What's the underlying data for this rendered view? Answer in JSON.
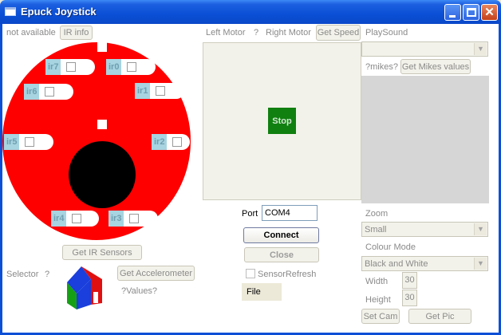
{
  "window": {
    "title": "Epuck Joystick"
  },
  "ir": {
    "status": "not available",
    "info_button": "IR info",
    "sensors": [
      "ir0",
      "ir1",
      "ir2",
      "ir3",
      "ir4",
      "ir5",
      "ir6",
      "ir7"
    ],
    "get_button": "Get IR Sensors"
  },
  "motor": {
    "left_label": "Left Motor",
    "value": "?",
    "right_label": "Right Motor",
    "get_speed_button": "Get Speed",
    "stop_button": "Stop"
  },
  "connection": {
    "port_label": "Port",
    "port_value": "COM4",
    "connect_button": "Connect",
    "close_button": "Close",
    "sensor_refresh_label": "SensorRefresh",
    "file_label": "File"
  },
  "selector": {
    "label": "Selector",
    "value": "?"
  },
  "accel": {
    "button": "Get Accelerometer",
    "values": "?Values?"
  },
  "sound": {
    "label": "PlaySound",
    "selected": "",
    "mikes_label": "?mikes?",
    "mikes_button": "Get Mikes values"
  },
  "camera": {
    "zoom_label": "Zoom",
    "zoom_value": "Small",
    "colour_label": "Colour Mode",
    "colour_value": "Black and White",
    "width_label": "Width",
    "width_value": "30",
    "height_label": "Height",
    "height_value": "30",
    "set_cam_button": "Set Cam",
    "get_pic_button": "Get Pic"
  },
  "colors": {
    "robot": "#ff0000",
    "stop": "#108010",
    "titlebar": "#0a4fd6"
  }
}
